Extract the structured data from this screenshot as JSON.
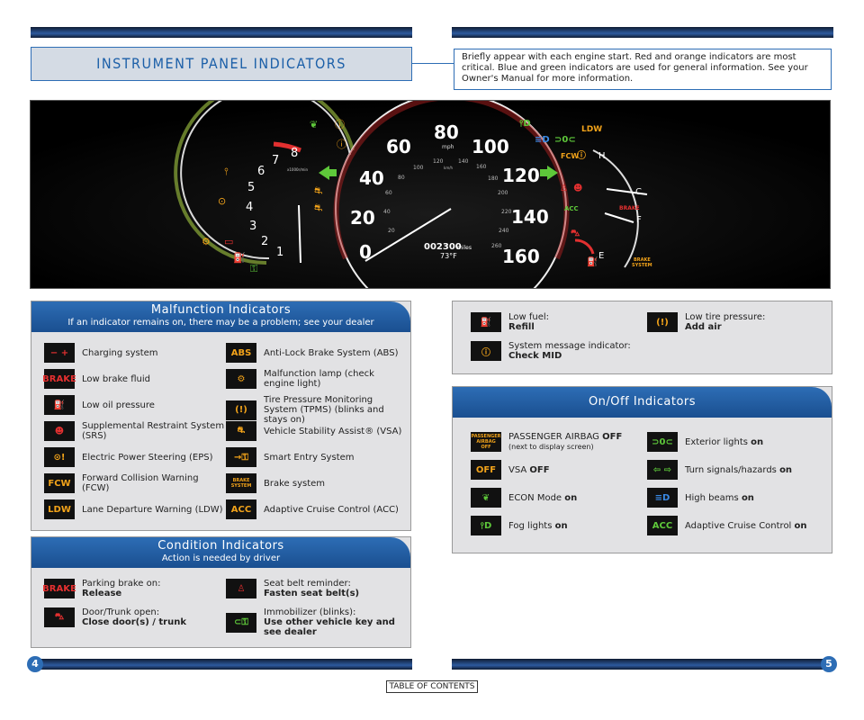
{
  "header": {
    "title": "INSTRUMENT PANEL INDICATORS",
    "intro": "Briefly appear with each engine start. Red and orange indicators are most critical. Blue and green indicators are used for general information. See your Owner's Manual for more information."
  },
  "dashboard": {
    "speed_ticks": [
      "0",
      "20",
      "40",
      "60",
      "80",
      "100",
      "120",
      "140",
      "160"
    ],
    "speed_unit": "mph",
    "kmh_ticks": [
      "20",
      "40",
      "60",
      "80",
      "100",
      "120",
      "140",
      "160",
      "180",
      "200",
      "220",
      "240",
      "260"
    ],
    "kmh_unit": "km/h",
    "rpm_ticks": [
      "1",
      "2",
      "3",
      "4",
      "5",
      "6",
      "7",
      "8"
    ],
    "rpm_unit": "x1000r/min",
    "odometer": "002300",
    "odometer_unit": "miles",
    "temperature": "73°F",
    "gauge_labels": {
      "hot": "H",
      "cold": "C",
      "full": "F",
      "empty": "E"
    },
    "labels": {
      "ldw": "LDW",
      "fcw": "FCW",
      "acc": "ACC",
      "brake": "BRAKE",
      "brake_system_1": "BRAKE",
      "brake_system_2": "SYSTEM"
    }
  },
  "malfunction": {
    "title": "Malfunction Indicators",
    "subtitle": "If an indicator remains on, there may be a problem; see your dealer",
    "left": [
      {
        "icon": "battery-icon",
        "glyph": "− +",
        "color": "red",
        "label": "Charging system"
      },
      {
        "icon": "brake-text-icon",
        "glyph": "BRAKE",
        "color": "red",
        "label": "Low brake fluid"
      },
      {
        "icon": "oil-can-icon",
        "glyph": "⛽",
        "color": "red",
        "label": "Low oil pressure"
      },
      {
        "icon": "airbag-icon",
        "glyph": "☻",
        "color": "red",
        "label": "Supplemental Restraint System (SRS)"
      },
      {
        "icon": "steering-icon",
        "glyph": "⊙!",
        "color": "amber",
        "label": "Electric Power Steering (EPS)"
      },
      {
        "icon": "fcw-text-icon",
        "glyph": "FCW",
        "color": "amber",
        "label": "Forward Collision Warning (FCW)"
      },
      {
        "icon": "ldw-text-icon",
        "glyph": "LDW",
        "color": "amber",
        "label": "Lane Departure Warning (LDW)"
      }
    ],
    "right": [
      {
        "icon": "abs-icon",
        "glyph": "ABS",
        "color": "amber",
        "label": "Anti-Lock Brake System (ABS)"
      },
      {
        "icon": "engine-icon",
        "glyph": "⚙",
        "color": "amber",
        "label": "Malfunction lamp (check engine light)"
      },
      {
        "icon": "tire-pressure-icon",
        "glyph": "(!)",
        "color": "amber",
        "label": "Tire Pressure Monitoring System (TPMS) (blinks and stays on)"
      },
      {
        "icon": "vsa-icon",
        "glyph": "⛐",
        "color": "amber",
        "label": "Vehicle Stability Assist® (VSA)"
      },
      {
        "icon": "smart-entry-icon",
        "glyph": "→⚿",
        "color": "amber",
        "label": "Smart Entry System"
      },
      {
        "icon": "brake-system-icon",
        "glyph": "BRAKE SYSTEM",
        "color": "amber",
        "label": "Brake system"
      },
      {
        "icon": "acc-text-icon",
        "glyph": "ACC",
        "color": "amber",
        "label": "Adaptive Cruise Control (ACC)"
      }
    ]
  },
  "condition": {
    "title": "Condition Indicators",
    "subtitle": "Action is needed by driver",
    "items": [
      {
        "icon": "parking-brake-icon",
        "glyph": "BRAKE",
        "color": "red",
        "line1": "Parking brake on:",
        "line2": "Release"
      },
      {
        "icon": "seatbelt-icon",
        "glyph": "♙",
        "color": "red",
        "line1": "Seat belt reminder:",
        "line2": "Fasten seat belt(s)"
      },
      {
        "icon": "door-open-icon",
        "glyph": "⛍",
        "color": "red",
        "line1": "Door/Trunk open:",
        "line2": "Close door(s) / trunk"
      },
      {
        "icon": "immobilizer-icon",
        "glyph": "⊂⚿",
        "color": "green",
        "line1": "Immobilizer (blinks):",
        "line2": "Use other vehicle key and see dealer"
      }
    ]
  },
  "info": {
    "items": [
      {
        "icon": "fuel-icon",
        "glyph": "⛽",
        "color": "amber",
        "line1": "Low fuel:",
        "line2": "Refill"
      },
      {
        "icon": "tire-pressure-icon",
        "glyph": "(!)",
        "color": "amber",
        "line1": "Low tire pressure:",
        "line2": "Add air"
      },
      {
        "icon": "info-icon",
        "glyph": "ⓘ",
        "color": "amber",
        "line1": "System message indicator:",
        "line2": "Check MID"
      }
    ]
  },
  "onoff": {
    "title": "On/Off Indicators",
    "left": [
      {
        "icon": "passenger-airbag-icon",
        "glyph": "PASSENGER AIRBAG OFF",
        "color": "amber",
        "label": "PASSENGER AIRBAG",
        "bold": "OFF",
        "sub": "(next to display screen)"
      },
      {
        "icon": "vsa-off-icon",
        "glyph": "OFF",
        "color": "amber",
        "label": "VSA",
        "bold": "OFF",
        "sub": ""
      },
      {
        "icon": "econ-icon",
        "glyph": "❦",
        "color": "green",
        "label": "ECON Mode",
        "bold": "on",
        "sub": ""
      },
      {
        "icon": "fog-lights-icon",
        "glyph": "⫯D",
        "color": "green",
        "label": "Fog lights",
        "bold": "on",
        "sub": ""
      }
    ],
    "right": [
      {
        "icon": "exterior-lights-icon",
        "glyph": "⊃0⊂",
        "color": "green",
        "label": "Exterior lights",
        "bold": "on"
      },
      {
        "icon": "turn-signal-icon",
        "glyph": "⇦ ⇨",
        "color": "green",
        "label": "Turn signals/hazards",
        "bold": "on"
      },
      {
        "icon": "high-beam-icon",
        "glyph": "≡D",
        "color": "blue",
        "label": "High beams",
        "bold": "on"
      },
      {
        "icon": "acc-on-icon",
        "glyph": "ACC",
        "color": "green",
        "label": "Adaptive Cruise Control",
        "bold": "on"
      }
    ]
  },
  "footer": {
    "page_left": "4",
    "page_right": "5",
    "toc": "TABLE OF CONTENTS"
  }
}
